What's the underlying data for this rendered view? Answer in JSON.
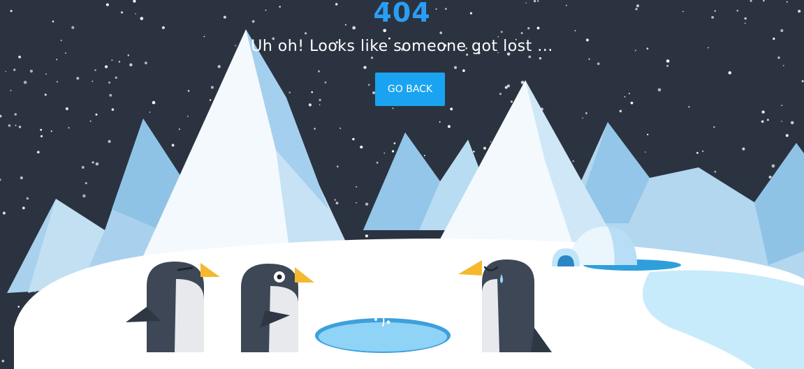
{
  "page": {
    "error_code": "404",
    "message": "Uh oh! Looks like someone got lost ...",
    "back_button_label": "GO BACK"
  },
  "colors": {
    "background": "#2b3341",
    "accent": "#1aa3f0",
    "heading": "#2a9df4",
    "ice_light": "#c9e4f5",
    "ice_mid": "#8fc3e6",
    "snow": "#ffffff",
    "penguin_body": "#3d4755",
    "penguin_beak": "#f5b82e",
    "water": "#8fd3f7"
  },
  "illustration": {
    "penguins": [
      "winking-penguin",
      "surprised-penguin",
      "sad-penguin"
    ],
    "props": [
      "igloo",
      "ice-fishing-hole",
      "frozen-stream"
    ]
  }
}
